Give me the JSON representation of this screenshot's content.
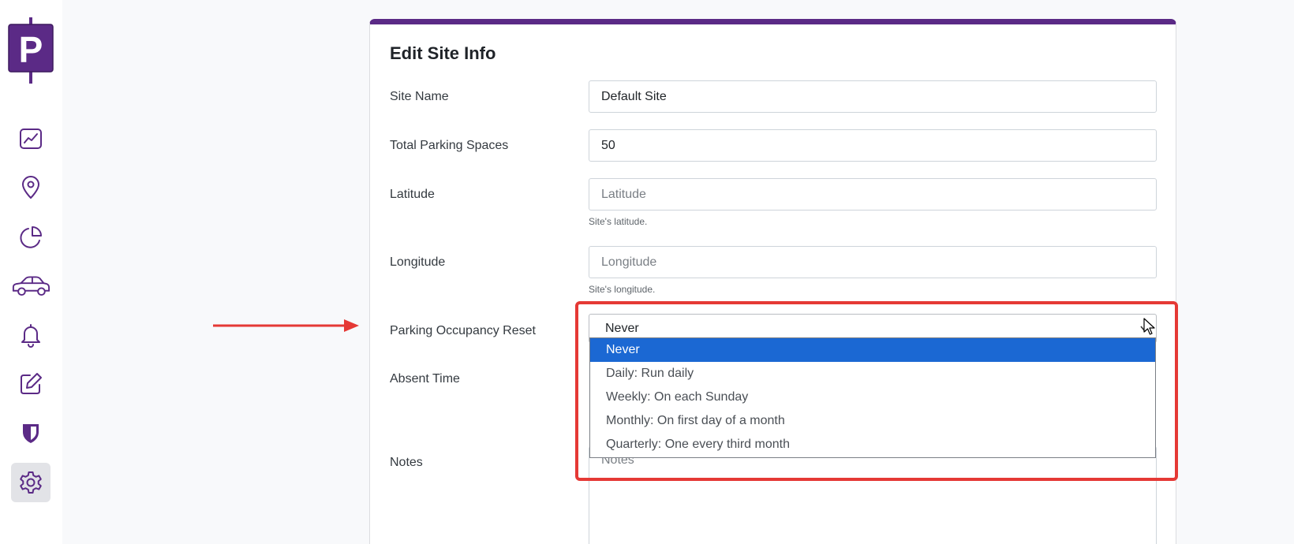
{
  "app": {
    "logo_letter": "P"
  },
  "sidebar": {
    "items": [
      {
        "icon": "chart-line-icon"
      },
      {
        "icon": "map-pin-icon"
      },
      {
        "icon": "pie-chart-icon"
      },
      {
        "icon": "car-icon"
      },
      {
        "icon": "bell-icon"
      },
      {
        "icon": "edit-icon"
      },
      {
        "icon": "shield-icon"
      },
      {
        "icon": "gear-icon",
        "active": true
      }
    ]
  },
  "form": {
    "title": "Edit Site Info",
    "site_name": {
      "label": "Site Name",
      "value": "Default Site"
    },
    "total_spaces": {
      "label": "Total Parking Spaces",
      "value": "50"
    },
    "latitude": {
      "label": "Latitude",
      "placeholder": "Latitude",
      "help": "Site's latitude."
    },
    "longitude": {
      "label": "Longitude",
      "placeholder": "Longitude",
      "help": "Site's longitude."
    },
    "occupancy_reset": {
      "label": "Parking Occupancy Reset",
      "value": "Never",
      "options": [
        "Never",
        "Daily: Run daily",
        "Weekly: On each Sunday",
        "Monthly: On first day of a month",
        "Quarterly: One every third month"
      ]
    },
    "absent_time": {
      "label": "Absent Time"
    },
    "notes": {
      "label": "Notes",
      "placeholder": "Notes"
    }
  },
  "colors": {
    "brand": "#5b2a86",
    "highlight": "#e53935",
    "selected_option": "#1b68d3"
  }
}
